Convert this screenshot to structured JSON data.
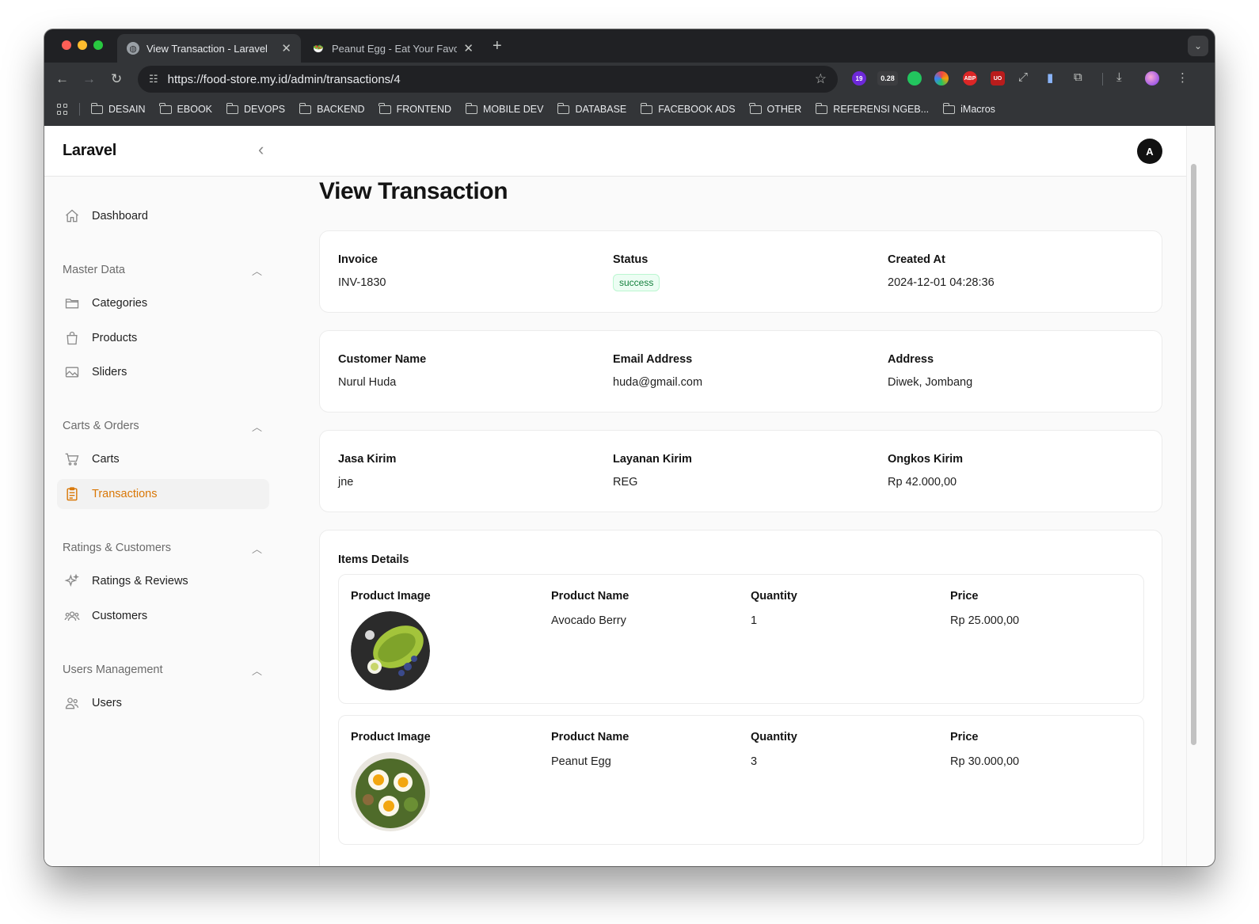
{
  "browser": {
    "tabs": [
      {
        "title": "View Transaction - Laravel",
        "active": true
      },
      {
        "title": "Peanut Egg - Eat Your Favorit",
        "active": false
      }
    ],
    "url": "https://food-store.my.id/admin/transactions/4",
    "extensions": [
      {
        "name": "ext-badge-19",
        "badge": "19",
        "color": "#6d28d9"
      },
      {
        "name": "ext-badge-028",
        "badge": "0.28",
        "color": "#3c3d40"
      },
      {
        "name": "ext-green-dot",
        "badge": "",
        "color": "#22c55e"
      },
      {
        "name": "ext-ring",
        "badge": "",
        "color": "#f59e0b"
      },
      {
        "name": "ext-abp",
        "badge": "ABP",
        "color": "#dc2626"
      },
      {
        "name": "ext-ublock",
        "badge": "UO",
        "color": "#b91c1c"
      }
    ],
    "bookmarks": [
      "DESAIN",
      "EBOOK",
      "DEVOPS",
      "BACKEND",
      "FRONTEND",
      "MOBILE DEV",
      "DATABASE",
      "FACEBOOK ADS",
      "OTHER",
      "REFERENSI NGEB...",
      "iMacros"
    ]
  },
  "app": {
    "brand": "Laravel",
    "avatar_initial": "A"
  },
  "sidebar": {
    "dashboard": "Dashboard",
    "groups": [
      {
        "label": "Master Data",
        "items": [
          "Categories",
          "Products",
          "Sliders"
        ]
      },
      {
        "label": "Carts & Orders",
        "items": [
          "Carts",
          "Transactions"
        ]
      },
      {
        "label": "Ratings & Customers",
        "items": [
          "Ratings & Reviews",
          "Customers"
        ]
      },
      {
        "label": "Users Management",
        "items": [
          "Users"
        ]
      }
    ],
    "active_item": "Transactions",
    "active_color": "#d97706"
  },
  "page": {
    "title": "View Transaction",
    "invoice": {
      "label": "Invoice",
      "value": "INV-1830"
    },
    "status": {
      "label": "Status",
      "value": "success",
      "color": "#15803d"
    },
    "created_at": {
      "label": "Created At",
      "value": "2024-12-01 04:28:36"
    },
    "customer_name": {
      "label": "Customer Name",
      "value": "Nurul Huda"
    },
    "email": {
      "label": "Email Address",
      "value": "huda@gmail.com"
    },
    "address": {
      "label": "Address",
      "value": "Diwek, Jombang"
    },
    "jasa_kirim": {
      "label": "Jasa Kirim",
      "value": "jne"
    },
    "layanan_kirim": {
      "label": "Layanan Kirim",
      "value": "REG"
    },
    "ongkos_kirim": {
      "label": "Ongkos Kirim",
      "value": "Rp 42.000,00"
    },
    "items_title": "Items Details",
    "item_labels": {
      "image": "Product Image",
      "name": "Product Name",
      "quantity": "Quantity",
      "price": "Price"
    },
    "items": [
      {
        "name": "Avocado Berry",
        "quantity": "1",
        "price": "Rp 25.000,00",
        "image_icon": "avocado-bowl-photo"
      },
      {
        "name": "Peanut Egg",
        "quantity": "3",
        "price": "Rp 30.000,00",
        "image_icon": "egg-salad-photo"
      }
    ]
  }
}
